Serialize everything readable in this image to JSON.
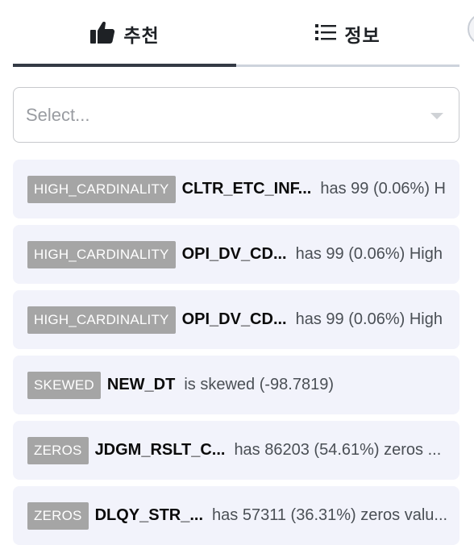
{
  "tabs": [
    {
      "label": "추천",
      "icon": "thumbs-up-icon",
      "active": true
    },
    {
      "label": "정보",
      "icon": "list-icon",
      "active": false
    }
  ],
  "select": {
    "placeholder": "Select..."
  },
  "alerts": [
    {
      "badge": "HIGH_CARDINALITY",
      "column": "CLTR_ETC_INF...",
      "message": "has 99 (0.06%) H"
    },
    {
      "badge": "HIGH_CARDINALITY",
      "column": "OPI_DV_CD...",
      "message": "has 99 (0.06%) High"
    },
    {
      "badge": "HIGH_CARDINALITY",
      "column": "OPI_DV_CD...",
      "message": "has 99 (0.06%) High"
    },
    {
      "badge": "SKEWED",
      "column": "NEW_DT",
      "message": "is skewed (-98.7819)"
    },
    {
      "badge": "ZEROS",
      "column": "JDGM_RSLT_C...",
      "message": "has 86203 (54.61%) zeros ..."
    },
    {
      "badge": "ZEROS",
      "column": "DLQY_STR_...",
      "message": "has 57311 (36.31%) zeros valu..."
    }
  ],
  "colors": {
    "badge": "#a5a5a5",
    "row_bg": "#f2f3fb",
    "tab_active": "#343a45",
    "tab_inactive": "#cdd3dc"
  }
}
